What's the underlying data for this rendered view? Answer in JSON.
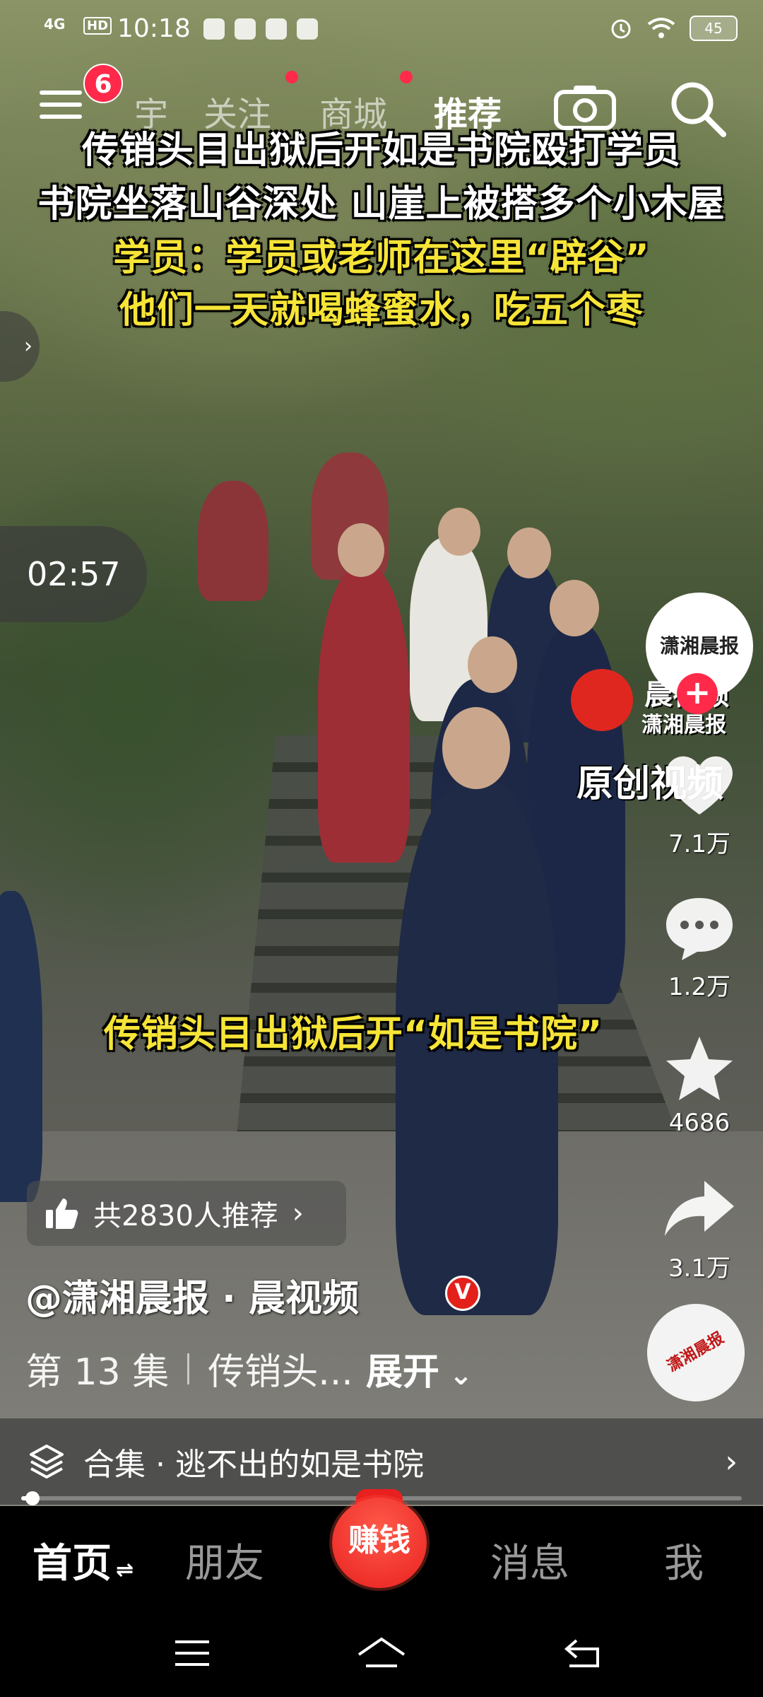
{
  "status_bar": {
    "network": "4G",
    "hd": "HD",
    "time": "10:18",
    "battery": "45"
  },
  "top_nav": {
    "notification_count": "6",
    "tabs": [
      {
        "label": "宇",
        "active": false
      },
      {
        "label": "关注",
        "active": false
      },
      {
        "label": "商城",
        "active": false
      },
      {
        "label": "推荐",
        "active": true
      }
    ]
  },
  "captions": {
    "line1": "传销头目出狱后开如是书院殴打学员",
    "line2": "书院坐落山谷深处 山崖上被搭多个小木屋",
    "line3": "学员：学员或老师在这里“辟谷”",
    "line4": "他们一天就喝蜂蜜水，吃五个枣",
    "middle": "传销头目出狱后开“如是书院”"
  },
  "video": {
    "duration": "02:57",
    "watermark_title": "晨视频",
    "watermark_sub": "潇湘晨报",
    "watermark_original": "原创视频"
  },
  "right_rail": {
    "avatar_text": "潇湘晨报",
    "follow": "+",
    "likes": "7.1万",
    "comments": "1.2万",
    "favorites": "4686",
    "shares": "3.1万",
    "disc_text": "潇湘晨报"
  },
  "info": {
    "recommend": "共2830人推荐",
    "author": "@潇湘晨报 · 晨视频",
    "verified": "V",
    "episode": "第 13 集",
    "title_preview": "传销头...",
    "expand": "展开",
    "collection": "合集 · 逃不出的如是书院",
    "progress_fraction": 0.01
  },
  "bottom_tabs": {
    "home": "首页",
    "friends": "朋友",
    "earn": "赚钱",
    "messages": "消息",
    "me": "我"
  },
  "colors": {
    "accent_red": "#ff2a4a",
    "caption_yellow": "#f6e437"
  }
}
